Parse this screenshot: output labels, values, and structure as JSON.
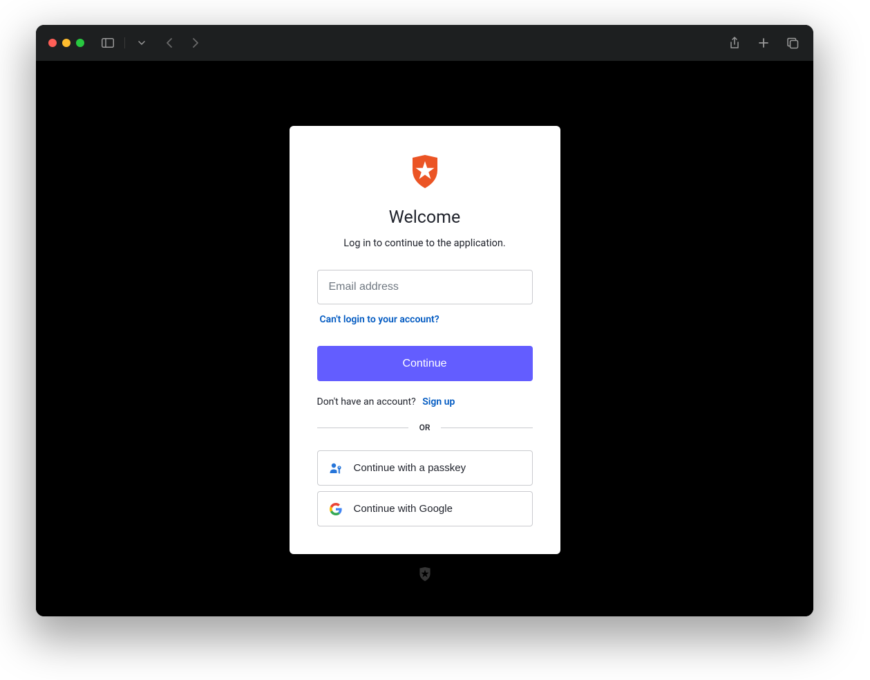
{
  "colors": {
    "accent": "#635dff",
    "link": "#0059c1",
    "brand": "#eb5424"
  },
  "login": {
    "title": "Welcome",
    "subtitle": "Log in to continue to the application.",
    "email_placeholder": "Email address",
    "help_link": "Can't login to your account?",
    "continue_label": "Continue",
    "signup_prompt": "Don't have an account?",
    "signup_link": "Sign up",
    "divider": "OR",
    "alt_buttons": {
      "passkey": "Continue with a passkey",
      "google": "Continue with Google"
    }
  }
}
